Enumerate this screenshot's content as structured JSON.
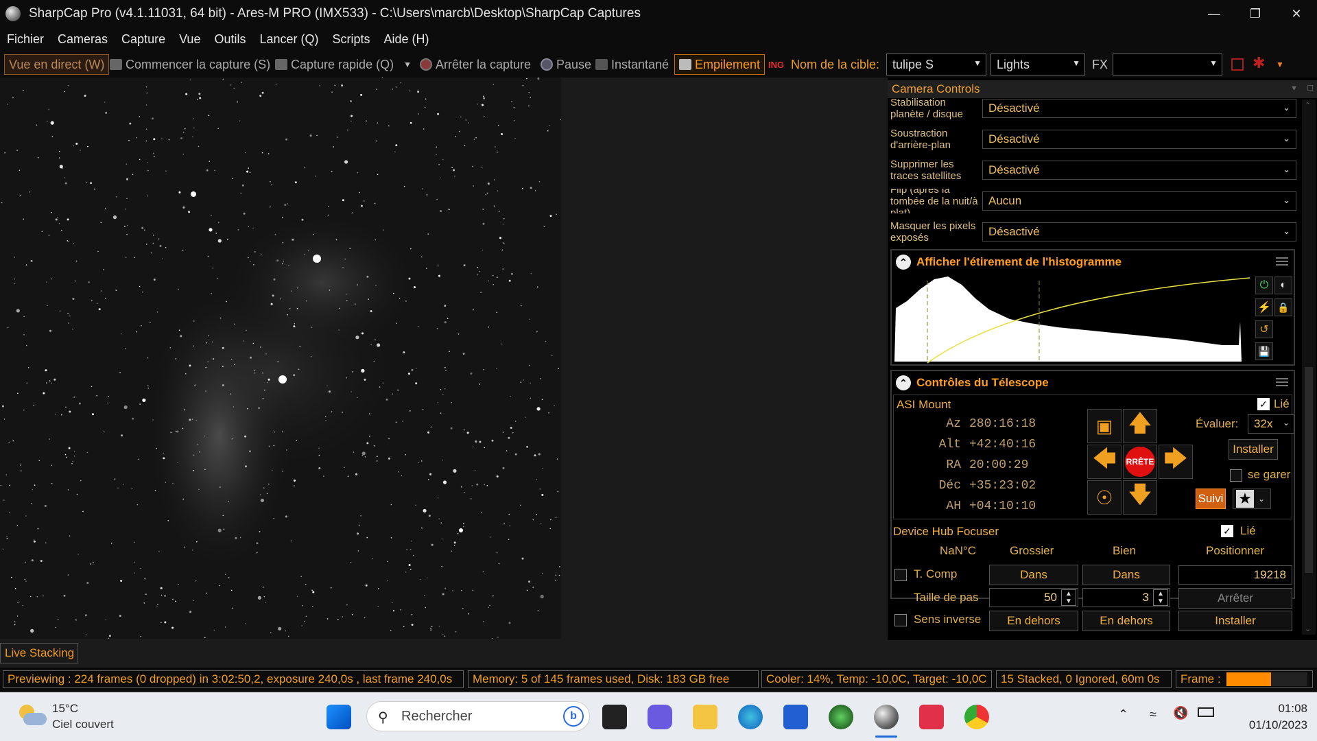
{
  "window": {
    "title": "SharpCap Pro (v4.1.11031, 64 bit) - Ares-M PRO (IMX533) - C:\\Users\\marcb\\Desktop\\SharpCap Captures"
  },
  "menu": [
    "Fichier",
    "Cameras",
    "Capture",
    "Vue",
    "Outils",
    "Lancer (Q)",
    "Scripts",
    "Aide (H)"
  ],
  "toolbar": {
    "live_view": "Vue en direct (W)",
    "start_capture": "Commencer la capture (S)",
    "quick_capture": "Capture rapide (Q)",
    "stop_capture": "Arrêter la capture",
    "pause": "Pause",
    "snapshot": "Instantané",
    "stacking": "Empilement",
    "target_label": "Nom de la cible:",
    "target_value": "tulipe S",
    "frame_type": "Lights",
    "fx_label": "FX",
    "fx_value": ""
  },
  "camera_controls": {
    "title": "Camera Controls",
    "rows": [
      {
        "label": "Stabilisation planète / disque",
        "value": "Désactivé"
      },
      {
        "label": "Soustraction d'arrière-plan",
        "value": "Désactivé"
      },
      {
        "label": "Supprimer les traces satellites",
        "value": "Désactivé"
      },
      {
        "label": "Flip (après la tombée de la nuit/à plat)",
        "value": "Aucun"
      },
      {
        "label": "Masquer les pixels exposés",
        "value": "Désactivé"
      }
    ]
  },
  "histogram": {
    "title": "Afficher l'étirement de l'histogramme"
  },
  "telescope": {
    "title": "Contrôles du Télescope",
    "mount": "ASI Mount",
    "linked": "Lié",
    "coords": [
      {
        "label": "Az",
        "value": "280:16:18"
      },
      {
        "label": "Alt",
        "value": "+42:40:16"
      },
      {
        "label": "RA",
        "value": "20:00:29"
      },
      {
        "label": "Déc",
        "value": "+35:23:02"
      },
      {
        "label": "AH",
        "value": "+04:10:10"
      }
    ],
    "stop": "RRÊTE",
    "rate_label": "Évaluer:",
    "rate": "32x",
    "install": "Installer",
    "park": "se garer",
    "tracking": "Suivi"
  },
  "focuser": {
    "title": "Device Hub Focuser",
    "linked": "Lié",
    "temp": "NaN°C",
    "coarse": "Grossier",
    "fine": "Bien",
    "position_label": "Positionner",
    "tcomp": "T. Comp",
    "in": "Dans",
    "position": "19218",
    "step_label": "Taille de pas",
    "coarse_step": "50",
    "fine_step": "3",
    "stop": "Arrêter",
    "reverse": "Sens inverse",
    "out": "En dehors",
    "install": "Installer"
  },
  "status": {
    "tab": "Live Stacking",
    "preview": "Previewing : 224 frames (0 dropped) in 3:02:50,2, exposure 240,0s , last frame 240,0s",
    "memory": "Memory: 5 of 145 frames used, Disk: 183 GB free",
    "cooler": "Cooler: 14%, Temp: -10,0C, Target: -10,0C",
    "stacked": "15 Stacked, 0 Ignored, 60m 0s",
    "frame": "Frame :",
    "frame_progress": 0.55
  },
  "taskbar": {
    "temp": "15°C",
    "weather": "Ciel couvert",
    "search": "Rechercher",
    "time": "01:08",
    "date": "01/10/2023"
  }
}
